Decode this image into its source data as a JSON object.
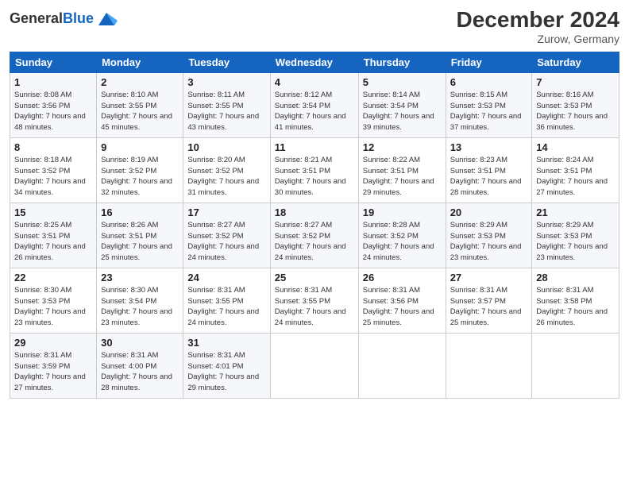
{
  "logo": {
    "general": "General",
    "blue": "Blue"
  },
  "header": {
    "month": "December 2024",
    "location": "Zurow, Germany"
  },
  "weekdays": [
    "Sunday",
    "Monday",
    "Tuesday",
    "Wednesday",
    "Thursday",
    "Friday",
    "Saturday"
  ],
  "weeks": [
    [
      {
        "day": "1",
        "sunrise": "Sunrise: 8:08 AM",
        "sunset": "Sunset: 3:56 PM",
        "daylight": "Daylight: 7 hours and 48 minutes."
      },
      {
        "day": "2",
        "sunrise": "Sunrise: 8:10 AM",
        "sunset": "Sunset: 3:55 PM",
        "daylight": "Daylight: 7 hours and 45 minutes."
      },
      {
        "day": "3",
        "sunrise": "Sunrise: 8:11 AM",
        "sunset": "Sunset: 3:55 PM",
        "daylight": "Daylight: 7 hours and 43 minutes."
      },
      {
        "day": "4",
        "sunrise": "Sunrise: 8:12 AM",
        "sunset": "Sunset: 3:54 PM",
        "daylight": "Daylight: 7 hours and 41 minutes."
      },
      {
        "day": "5",
        "sunrise": "Sunrise: 8:14 AM",
        "sunset": "Sunset: 3:54 PM",
        "daylight": "Daylight: 7 hours and 39 minutes."
      },
      {
        "day": "6",
        "sunrise": "Sunrise: 8:15 AM",
        "sunset": "Sunset: 3:53 PM",
        "daylight": "Daylight: 7 hours and 37 minutes."
      },
      {
        "day": "7",
        "sunrise": "Sunrise: 8:16 AM",
        "sunset": "Sunset: 3:53 PM",
        "daylight": "Daylight: 7 hours and 36 minutes."
      }
    ],
    [
      {
        "day": "8",
        "sunrise": "Sunrise: 8:18 AM",
        "sunset": "Sunset: 3:52 PM",
        "daylight": "Daylight: 7 hours and 34 minutes."
      },
      {
        "day": "9",
        "sunrise": "Sunrise: 8:19 AM",
        "sunset": "Sunset: 3:52 PM",
        "daylight": "Daylight: 7 hours and 32 minutes."
      },
      {
        "day": "10",
        "sunrise": "Sunrise: 8:20 AM",
        "sunset": "Sunset: 3:52 PM",
        "daylight": "Daylight: 7 hours and 31 minutes."
      },
      {
        "day": "11",
        "sunrise": "Sunrise: 8:21 AM",
        "sunset": "Sunset: 3:51 PM",
        "daylight": "Daylight: 7 hours and 30 minutes."
      },
      {
        "day": "12",
        "sunrise": "Sunrise: 8:22 AM",
        "sunset": "Sunset: 3:51 PM",
        "daylight": "Daylight: 7 hours and 29 minutes."
      },
      {
        "day": "13",
        "sunrise": "Sunrise: 8:23 AM",
        "sunset": "Sunset: 3:51 PM",
        "daylight": "Daylight: 7 hours and 28 minutes."
      },
      {
        "day": "14",
        "sunrise": "Sunrise: 8:24 AM",
        "sunset": "Sunset: 3:51 PM",
        "daylight": "Daylight: 7 hours and 27 minutes."
      }
    ],
    [
      {
        "day": "15",
        "sunrise": "Sunrise: 8:25 AM",
        "sunset": "Sunset: 3:51 PM",
        "daylight": "Daylight: 7 hours and 26 minutes."
      },
      {
        "day": "16",
        "sunrise": "Sunrise: 8:26 AM",
        "sunset": "Sunset: 3:51 PM",
        "daylight": "Daylight: 7 hours and 25 minutes."
      },
      {
        "day": "17",
        "sunrise": "Sunrise: 8:27 AM",
        "sunset": "Sunset: 3:52 PM",
        "daylight": "Daylight: 7 hours and 24 minutes."
      },
      {
        "day": "18",
        "sunrise": "Sunrise: 8:27 AM",
        "sunset": "Sunset: 3:52 PM",
        "daylight": "Daylight: 7 hours and 24 minutes."
      },
      {
        "day": "19",
        "sunrise": "Sunrise: 8:28 AM",
        "sunset": "Sunset: 3:52 PM",
        "daylight": "Daylight: 7 hours and 24 minutes."
      },
      {
        "day": "20",
        "sunrise": "Sunrise: 8:29 AM",
        "sunset": "Sunset: 3:53 PM",
        "daylight": "Daylight: 7 hours and 23 minutes."
      },
      {
        "day": "21",
        "sunrise": "Sunrise: 8:29 AM",
        "sunset": "Sunset: 3:53 PM",
        "daylight": "Daylight: 7 hours and 23 minutes."
      }
    ],
    [
      {
        "day": "22",
        "sunrise": "Sunrise: 8:30 AM",
        "sunset": "Sunset: 3:53 PM",
        "daylight": "Daylight: 7 hours and 23 minutes."
      },
      {
        "day": "23",
        "sunrise": "Sunrise: 8:30 AM",
        "sunset": "Sunset: 3:54 PM",
        "daylight": "Daylight: 7 hours and 23 minutes."
      },
      {
        "day": "24",
        "sunrise": "Sunrise: 8:31 AM",
        "sunset": "Sunset: 3:55 PM",
        "daylight": "Daylight: 7 hours and 24 minutes."
      },
      {
        "day": "25",
        "sunrise": "Sunrise: 8:31 AM",
        "sunset": "Sunset: 3:55 PM",
        "daylight": "Daylight: 7 hours and 24 minutes."
      },
      {
        "day": "26",
        "sunrise": "Sunrise: 8:31 AM",
        "sunset": "Sunset: 3:56 PM",
        "daylight": "Daylight: 7 hours and 25 minutes."
      },
      {
        "day": "27",
        "sunrise": "Sunrise: 8:31 AM",
        "sunset": "Sunset: 3:57 PM",
        "daylight": "Daylight: 7 hours and 25 minutes."
      },
      {
        "day": "28",
        "sunrise": "Sunrise: 8:31 AM",
        "sunset": "Sunset: 3:58 PM",
        "daylight": "Daylight: 7 hours and 26 minutes."
      }
    ],
    [
      {
        "day": "29",
        "sunrise": "Sunrise: 8:31 AM",
        "sunset": "Sunset: 3:59 PM",
        "daylight": "Daylight: 7 hours and 27 minutes."
      },
      {
        "day": "30",
        "sunrise": "Sunrise: 8:31 AM",
        "sunset": "Sunset: 4:00 PM",
        "daylight": "Daylight: 7 hours and 28 minutes."
      },
      {
        "day": "31",
        "sunrise": "Sunrise: 8:31 AM",
        "sunset": "Sunset: 4:01 PM",
        "daylight": "Daylight: 7 hours and 29 minutes."
      },
      null,
      null,
      null,
      null
    ]
  ]
}
